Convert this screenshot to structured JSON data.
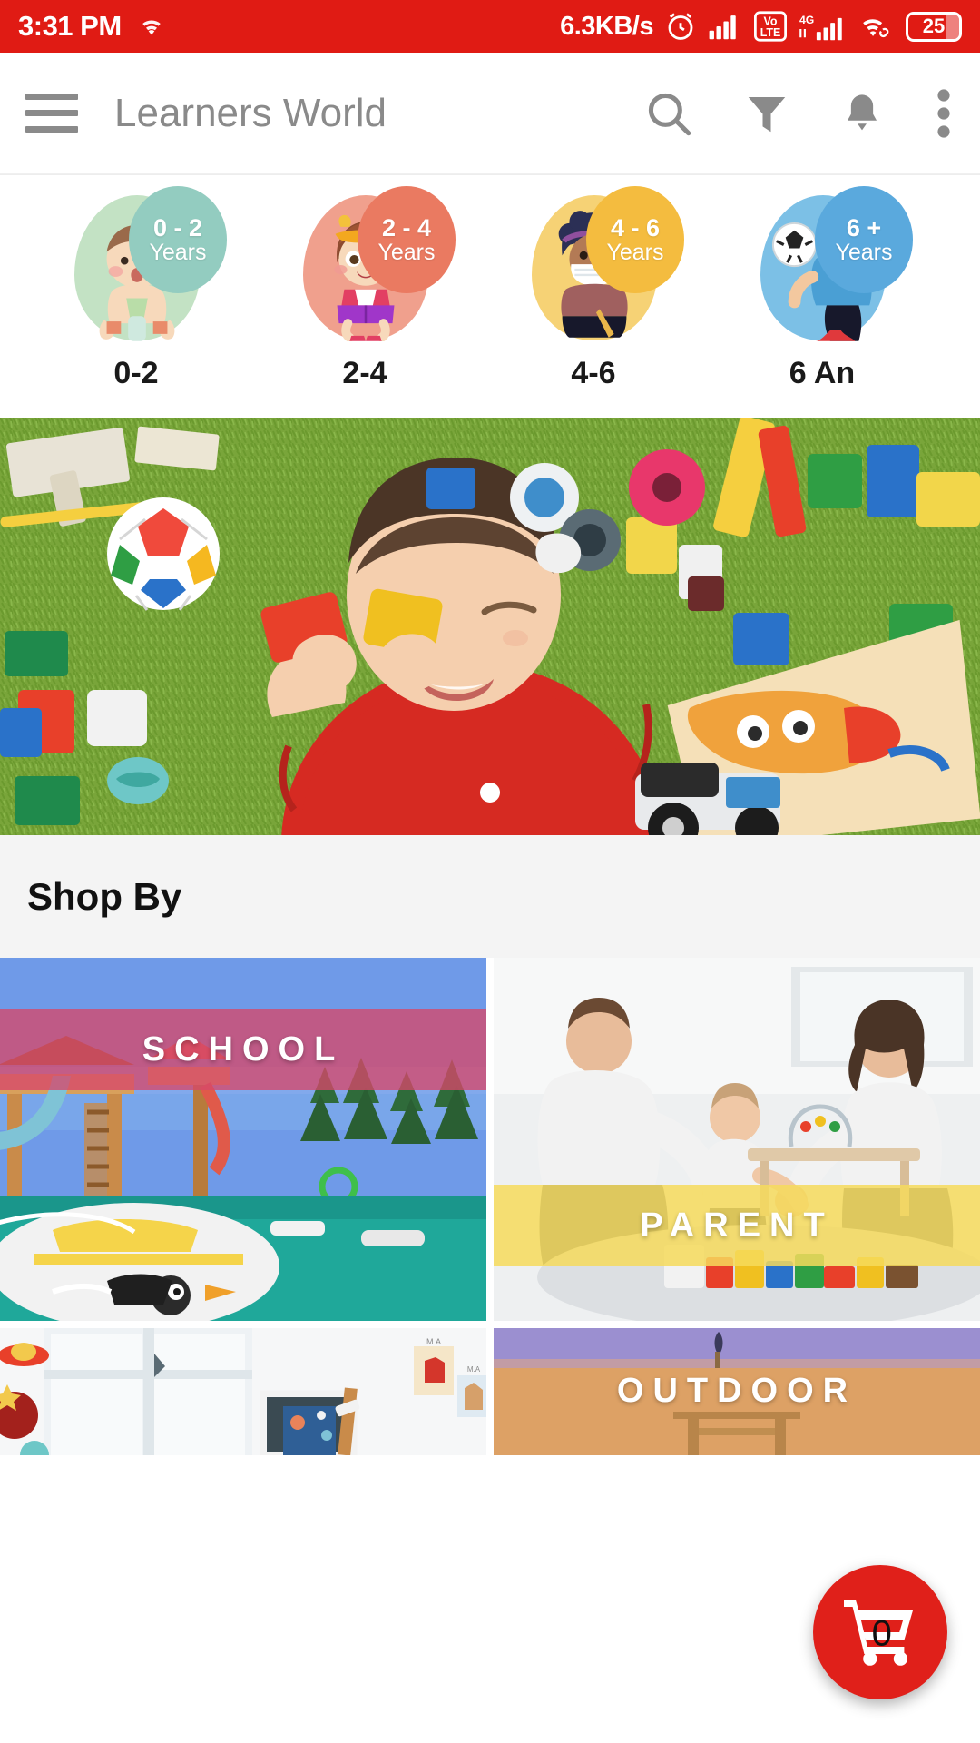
{
  "status_bar": {
    "time": "3:31 PM",
    "wifi_icon": "wifi-icon",
    "network_speed": "6.3KB/s",
    "alarm_icon": "alarm-icon",
    "signal_icon": "signal-bars-icon",
    "volte_label": "VoLTE",
    "volte_top": "Vo",
    "volte_bottom": "LTE",
    "net_type": "4G",
    "battery_level": "25",
    "background_color": "#e01b14"
  },
  "app_bar": {
    "menu_icon": "hamburger-menu-icon",
    "title": "Learners World",
    "search_icon": "search-icon",
    "filter_icon": "filter-icon",
    "notification_icon": "bell-icon",
    "overflow_icon": "more-vertical-icon"
  },
  "age_categories": [
    {
      "label": "0-2",
      "badge_range": "0 - 2",
      "badge_unit": "Years",
      "badge_color": "#93ccc0",
      "blob_color": "#c3e2c4"
    },
    {
      "label": "2-4",
      "badge_range": "2 - 4",
      "badge_unit": "Years",
      "badge_color": "#ea7a61",
      "blob_color": "#f0a08d"
    },
    {
      "label": "4-6",
      "badge_range": "4 - 6",
      "badge_unit": "Years",
      "badge_color": "#f4bc3f",
      "blob_color": "#f6d275"
    },
    {
      "label": "6 An",
      "badge_range": "6 +",
      "badge_unit": "Years",
      "badge_color": "#5aa9dd",
      "blob_color": "#7cc0e6"
    }
  ],
  "hero_banner": {
    "alt": "child lying on green grass rug playing with colorful blocks and toys",
    "indicator": "page-dot"
  },
  "shop_by": {
    "title": "Shop By"
  },
  "shop_categories": [
    {
      "label": "SCHOOL",
      "band_color": "rgba(214,72,106,0.78)",
      "image_alt": "outdoor playground with slides and climbing frames"
    },
    {
      "label": "PARENT",
      "band_color": "rgba(246,219,92,0.85)",
      "image_alt": "parents playing with toddler and building blocks on floor"
    },
    {
      "label": "",
      "band_color": "rgba(0,0,0,0)",
      "image_alt": "bright kids room with chalkboard easel and wall art"
    },
    {
      "label": "OUTDOOR",
      "band_color": "rgba(0,0,0,0)",
      "image_alt": "outdoor wooden play structure against sky"
    }
  ],
  "cart_fab": {
    "icon": "shopping-cart-icon",
    "count": "0",
    "color": "#e0201a"
  }
}
